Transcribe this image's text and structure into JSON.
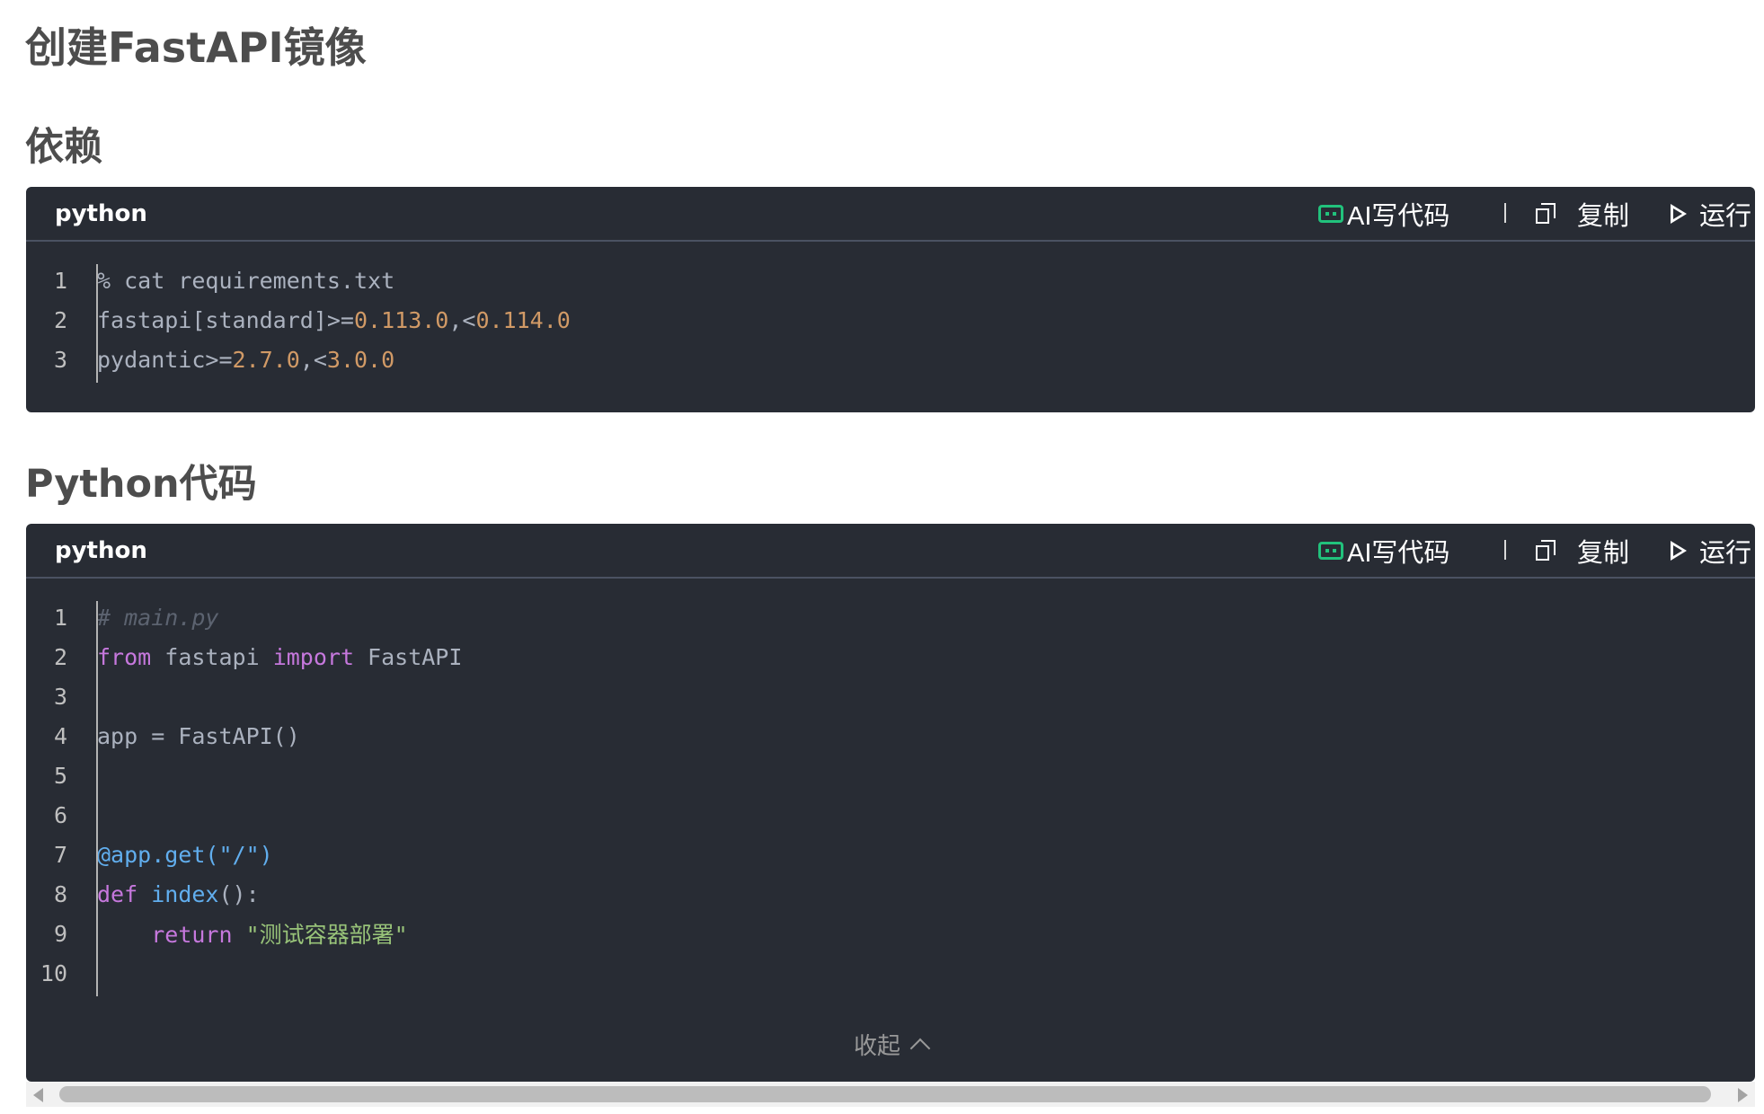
{
  "page_title": "创建FastAPI镜像",
  "sections": [
    {
      "title": "依赖",
      "language": "python",
      "toolbar": {
        "ai_label": "AI写代码",
        "copy_label": "复制",
        "run_label": "运行"
      },
      "lines": [
        {
          "no": "1",
          "text": "% cat requirements.txt"
        },
        {
          "no": "2",
          "text": "fastapi[standard]>=0.113.0,<0.114.0"
        },
        {
          "no": "3",
          "text": "pydantic>=2.7.0,<3.0.0"
        }
      ]
    },
    {
      "title": "Python代码",
      "language": "python",
      "toolbar": {
        "ai_label": "AI写代码",
        "copy_label": "复制",
        "run_label": "运行"
      },
      "lines": [
        {
          "no": "1",
          "text": "# main.py"
        },
        {
          "no": "2",
          "text": "from fastapi import FastAPI"
        },
        {
          "no": "3",
          "text": ""
        },
        {
          "no": "4",
          "text": "app = FastAPI()"
        },
        {
          "no": "5",
          "text": ""
        },
        {
          "no": "6",
          "text": ""
        },
        {
          "no": "7",
          "text": "@app.get(\"/\")"
        },
        {
          "no": "8",
          "text": "def index():"
        },
        {
          "no": "9",
          "text": "    return \"测试容器部署\""
        },
        {
          "no": "10",
          "text": ""
        }
      ],
      "collapse_label": "收起"
    }
  ],
  "colors": {
    "code_bg": "#282c34",
    "number": "#d19a66",
    "keyword": "#c678dd",
    "function": "#61aeee",
    "string": "#98c379",
    "comment": "#5c6370",
    "ai_icon": "#21c27c"
  },
  "icons": [
    "ai-icon",
    "copy-icon",
    "run-icon",
    "chevron-up-icon"
  ]
}
